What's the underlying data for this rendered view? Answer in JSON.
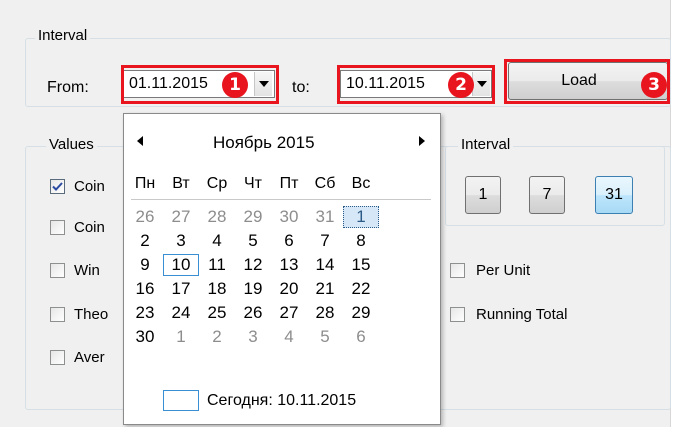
{
  "interval_group": {
    "label": "Interval",
    "from_label": "From:",
    "from_value": "01.11.2015",
    "to_label": "to:",
    "to_value": "10.11.2015",
    "load_label": "Load"
  },
  "annotations": [
    "1",
    "2",
    "3"
  ],
  "values_group": {
    "label": "Values",
    "items": [
      {
        "label": "Coin",
        "checked": true
      },
      {
        "label": "Coin",
        "checked": false
      },
      {
        "label": "Win",
        "checked": false
      },
      {
        "label": "Theo",
        "checked": false
      },
      {
        "label": "Aver",
        "checked": false
      }
    ]
  },
  "interval_buttons_group": {
    "label": "Interval",
    "buttons": [
      "1",
      "7",
      "31"
    ],
    "active": "31"
  },
  "options": {
    "per_unit": "Per Unit",
    "running_total": "Running Total"
  },
  "calendar": {
    "month_title": "Ноябрь 2015",
    "weekdays": [
      "Пн",
      "Вт",
      "Ср",
      "Чт",
      "Пт",
      "Сб",
      "Вс"
    ],
    "weeks": [
      [
        "26",
        "27",
        "28",
        "29",
        "30",
        "31",
        "1"
      ],
      [
        "2",
        "3",
        "4",
        "5",
        "6",
        "7",
        "8"
      ],
      [
        "9",
        "10",
        "11",
        "12",
        "13",
        "14",
        "15"
      ],
      [
        "16",
        "17",
        "18",
        "19",
        "20",
        "21",
        "22"
      ],
      [
        "23",
        "24",
        "25",
        "26",
        "27",
        "28",
        "29"
      ],
      [
        "30",
        "1",
        "2",
        "3",
        "4",
        "5",
        "6"
      ]
    ],
    "selected_day": "1",
    "today_day": "10",
    "today_label": "Сегодня: 10.11.2015"
  },
  "colors": {
    "annotation_red": "#e8141e",
    "today_blue": "#3a8ed1",
    "other_month_gray": "#8d8d8d"
  }
}
